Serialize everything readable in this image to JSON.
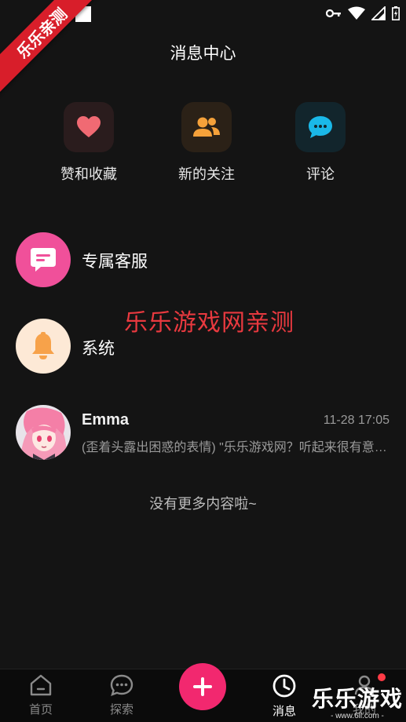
{
  "watermark": {
    "corner_ribbon": "乐乐亲测",
    "center_text": "乐乐游戏网亲测",
    "brand_text": "乐乐游戏",
    "brand_url": "- www.6ll.com -"
  },
  "header": {
    "title": "消息中心"
  },
  "quick_actions": [
    {
      "label": "赞和收藏",
      "icon": "heart-icon",
      "color": "#f06a73"
    },
    {
      "label": "新的关注",
      "icon": "users-icon",
      "color": "#f5a13a"
    },
    {
      "label": "评论",
      "icon": "comment-icon",
      "color": "#1ab8e8"
    }
  ],
  "list": {
    "service": {
      "label": "专属客服",
      "icon": "chat-icon",
      "color": "#f0509a"
    },
    "system": {
      "label": "系统",
      "icon": "bell-icon",
      "color": "#f7a24a"
    },
    "message": {
      "name": "Emma",
      "time": "11-28 17:05",
      "preview": "(歪着头露出困惑的表情) \"乐乐游戏网？听起来很有意思呢\""
    }
  },
  "footer_note": "没有更多内容啦~",
  "tabbar": {
    "home": "首页",
    "explore": "探索",
    "messages": "消息",
    "profile": "我的",
    "active": "messages",
    "fab_icon": "plus-icon",
    "accent": "#f2286f"
  }
}
